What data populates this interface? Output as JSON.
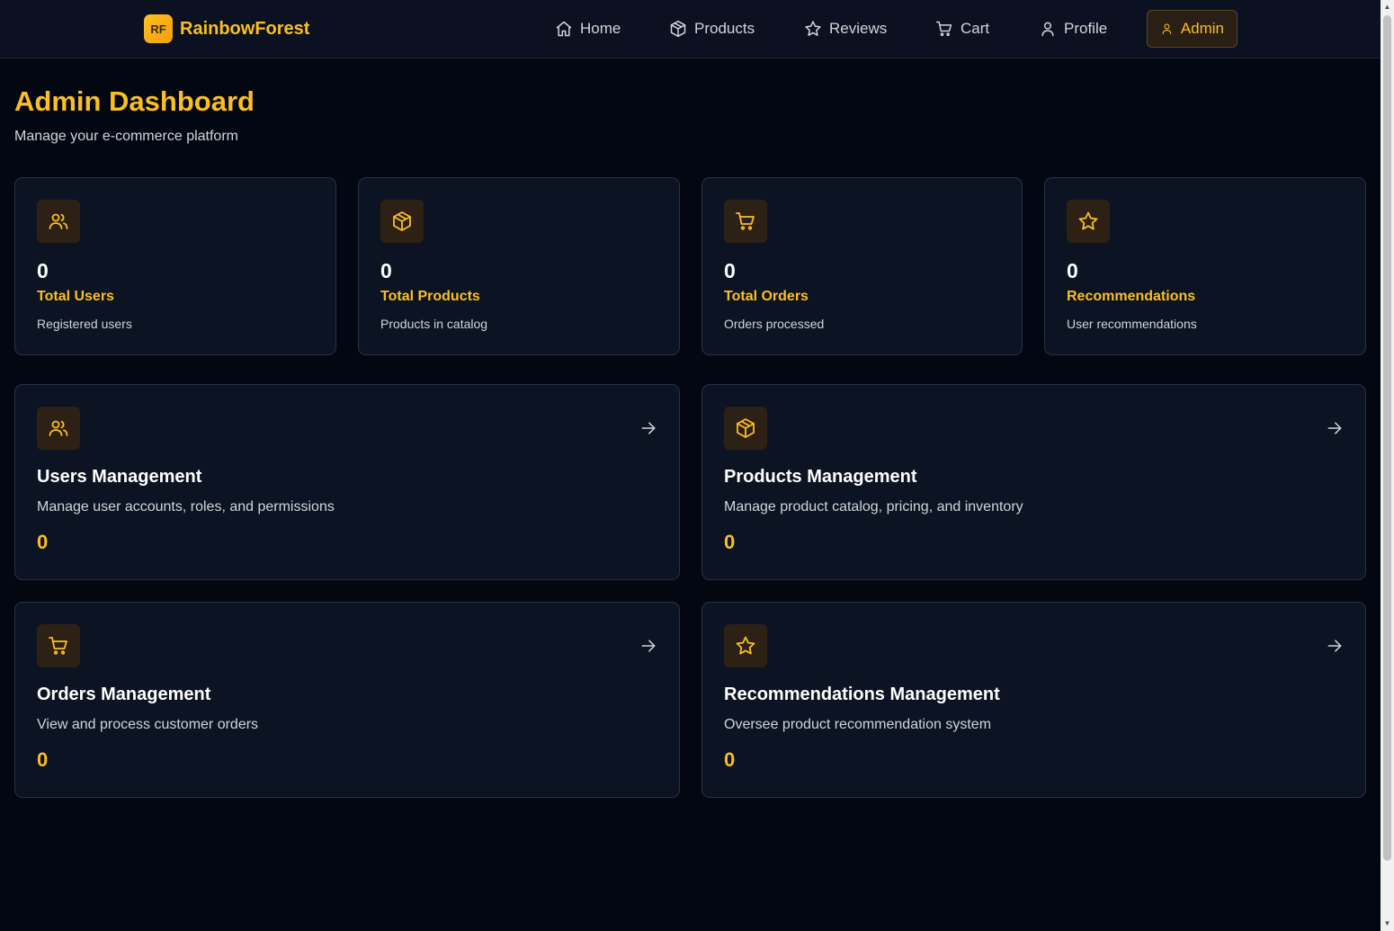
{
  "brand": {
    "logo_text": "RF",
    "name": "RainbowForest"
  },
  "nav": [
    {
      "label": "Home",
      "icon": "home-icon"
    },
    {
      "label": "Products",
      "icon": "box-icon"
    },
    {
      "label": "Reviews",
      "icon": "star-icon"
    },
    {
      "label": "Cart",
      "icon": "cart-icon"
    },
    {
      "label": "Profile",
      "icon": "user-icon"
    },
    {
      "label": "Admin",
      "icon": "user-icon",
      "active": true
    }
  ],
  "page": {
    "title": "Admin Dashboard",
    "subtitle": "Manage your e-commerce platform"
  },
  "stats": [
    {
      "value": "0",
      "label": "Total Users",
      "desc": "Registered users",
      "icon": "users-icon"
    },
    {
      "value": "0",
      "label": "Total Products",
      "desc": "Products in catalog",
      "icon": "box-icon"
    },
    {
      "value": "0",
      "label": "Total Orders",
      "desc": "Orders processed",
      "icon": "cart-icon"
    },
    {
      "value": "0",
      "label": "Recommendations",
      "desc": "User recommendations",
      "icon": "star-icon"
    }
  ],
  "management": [
    {
      "title": "Users Management",
      "desc": "Manage user accounts, roles, and permissions",
      "count": "0",
      "icon": "users-icon"
    },
    {
      "title": "Products Management",
      "desc": "Manage product catalog, pricing, and inventory",
      "count": "0",
      "icon": "box-icon"
    },
    {
      "title": "Orders Management",
      "desc": "View and process customer orders",
      "count": "0",
      "icon": "cart-icon"
    },
    {
      "title": "Recommendations Management",
      "desc": "Oversee product recommendation system",
      "count": "0",
      "icon": "star-icon"
    }
  ],
  "colors": {
    "accent": "#fbbf24",
    "background": "#030712",
    "card": "#0c1322",
    "border": "#273244"
  }
}
